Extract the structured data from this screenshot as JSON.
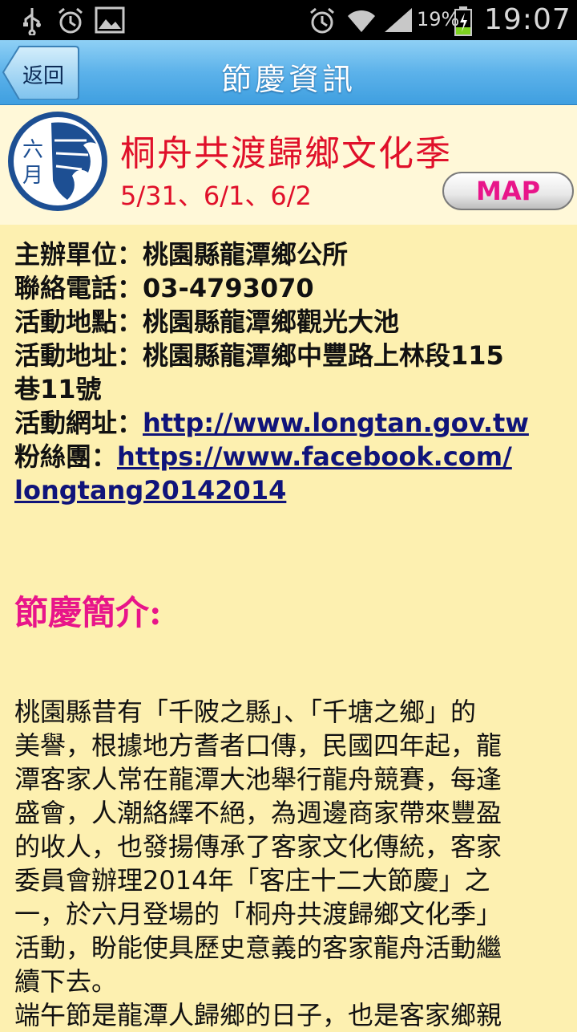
{
  "status_bar": {
    "battery_percent": "19%",
    "time": "19:07",
    "icons": [
      "usb-icon",
      "alarm-icon",
      "image-icon",
      "alarm-icon",
      "wifi-icon",
      "signal-icon",
      "battery-charging-icon"
    ]
  },
  "header": {
    "back_label": "返回",
    "title": "節慶資訊"
  },
  "banner": {
    "month_badge": "六月",
    "festival_name": "桐舟共渡歸鄉文化季",
    "dates": "5/31、6/1、6/2",
    "map_label": "MAP"
  },
  "info": {
    "organizer": "主辦單位：桃園縣龍潭鄉公所",
    "phone": "聯絡電話：03-4793070",
    "venue": "活動地點：桃園縣龍潭鄉觀光大池",
    "address_line1": "活動地址：桃園縣龍潭鄉中豐路上林段115",
    "address_line2": "巷11號",
    "website_label": "活動網址：",
    "website_url": "http://www.longtan.gov.tw",
    "fanpage_label": "粉絲團：",
    "fanpage_url_line1": "https://www.facebook.com/",
    "fanpage_url_line2": "longtang20142014"
  },
  "intro": {
    "heading": "節慶簡介:",
    "lines": [
      "桃園縣昔有「千陂之縣」、「千塘之鄉」的",
      "美譽，根據地方耆者口傳，民國四年起，龍",
      "潭客家人常在龍潭大池舉行龍舟競賽，每逢",
      "盛會，人潮絡繹不絕，為週邊商家帶來豐盈",
      "的收人，也發揚傳承了客家文化傳統，客家",
      "委員會辦理2014年「客庄十二大節慶」之",
      "一，於六月登場的「桐舟共渡歸鄉文化季」",
      "活動，盼能使具歷史意義的客家龍舟活動繼",
      "續下去。",
      "端午節是龍潭人歸鄉的日子，也是客家鄉親"
    ]
  },
  "colors": {
    "background": "#fdf0b0",
    "title_bar": "#5cb2ea",
    "festival_red": "#e0102a",
    "heading_pink": "#e8158a",
    "link_navy": "#10147a"
  }
}
